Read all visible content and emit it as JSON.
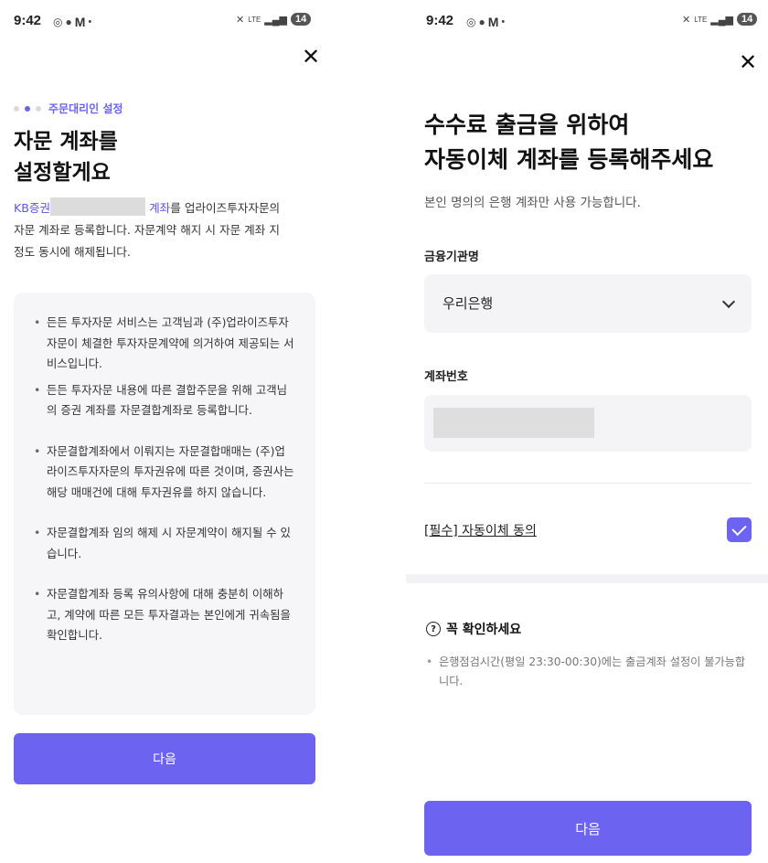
{
  "left_screen": {
    "status_bar": {
      "time": "9:42",
      "battery": "14",
      "network": "LTE"
    },
    "step_label": "주문대리인 설정",
    "title_line1": "자문 계좌를",
    "title_line2": "설정할게요",
    "desc_prefix": "KB증권",
    "desc_accent": "계좌",
    "desc_rest1": "를 업라이즈투자자문의",
    "desc_rest2": "자문 계좌로 등록합니다. 자문계약 해지 시 자문 계좌 지",
    "desc_rest3": "정도 동시에 해제됩니다.",
    "notices": [
      "든든 투자자문 서비스는 고객님과 (주)업라이즈투자자문이 체결한 투자자문계약에 의거하여 제공되는 서비스입니다.",
      "든든 투자자문 내용에 따른 결합주문을 위해 고객님의 증권 계좌를 자문결합계좌로 등록합니다.",
      "자문결합계좌에서 이뤄지는 자문결합매매는 (주)업라이즈투자자문의 투자권유에 따른 것이며, 증권사는 해당 매매건에 대해 투자권유를 하지 않습니다.",
      "자문결합계좌 임의 해제 시 자문계약이 해지될 수 있습니다.",
      "자문결합계좌 등록 유의사항에 대해 충분히 이해하고, 계약에 따른 모든 투자결과는 본인에게 귀속됨을 확인합니다."
    ],
    "next_label": "다음"
  },
  "right_screen": {
    "status_bar": {
      "time": "9:42",
      "battery": "14",
      "network": "LTE"
    },
    "title_line1": "수수료 출금을 위하여",
    "title_line2": "자동이체 계좌를 등록해주세요",
    "subtitle": "본인 명의의 은행 계좌만 사용 가능합니다.",
    "bank_label": "금융기관명",
    "bank_value": "우리은행",
    "account_label": "계좌번호",
    "agree_label": "[필수] 자동이체 동의",
    "agree_checked": true,
    "confirm_title": "꼭 확인하세요",
    "confirm_note": "은행점검시간(평일 23:30-00:30)에는 출금계좌 설정이 불가능합니다.",
    "next_label": "다음"
  },
  "colors": {
    "accent": "#6c63f0",
    "accent_text": "#5a56e0",
    "box_bg": "#f6f6f8"
  },
  "icons": {
    "close": "close-icon",
    "dropdown": "chevron-down-icon",
    "check": "check-icon",
    "help": "question-circle-icon"
  }
}
